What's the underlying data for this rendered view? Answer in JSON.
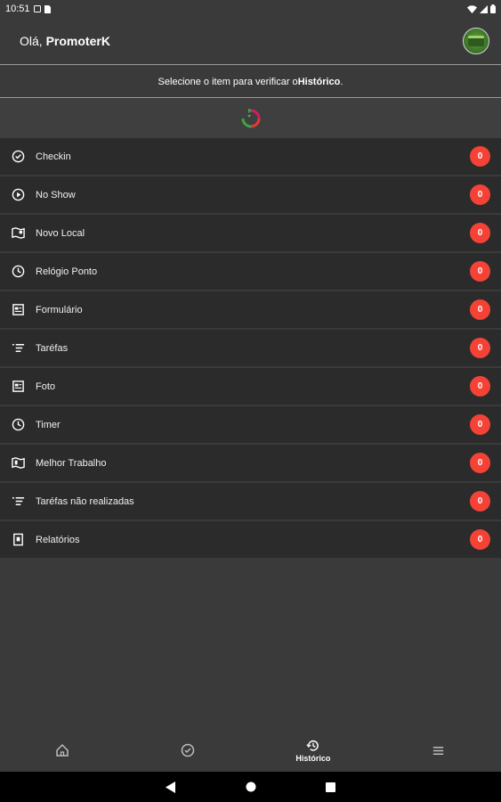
{
  "status_bar": {
    "time": "10:51"
  },
  "header": {
    "greeting_prefix": "Olá, ",
    "username": "PromoterK"
  },
  "banner": {
    "text_prefix": "Selecione o item para verificar o ",
    "text_bold": "Histórico",
    "text_suffix": "."
  },
  "list": [
    {
      "label": "Checkin",
      "count": "0",
      "icon": "check-circle-icon"
    },
    {
      "label": "No Show",
      "count": "0",
      "icon": "play-circle-icon"
    },
    {
      "label": "Novo Local",
      "count": "0",
      "icon": "map-icon"
    },
    {
      "label": "Relógio Ponto",
      "count": "0",
      "icon": "clock-icon"
    },
    {
      "label": "Formulário",
      "count": "0",
      "icon": "form-icon"
    },
    {
      "label": "Taréfas",
      "count": "0",
      "icon": "list-icon"
    },
    {
      "label": "Foto",
      "count": "0",
      "icon": "photo-icon"
    },
    {
      "label": "Timer",
      "count": "0",
      "icon": "clock-icon"
    },
    {
      "label": "Melhor Trabalho",
      "count": "0",
      "icon": "map-icon"
    },
    {
      "label": "Taréfas não realizadas",
      "count": "0",
      "icon": "list-icon"
    },
    {
      "label": "Relatórios",
      "count": "0",
      "icon": "report-icon"
    }
  ],
  "bottom_nav": {
    "active_label": "Histórico"
  },
  "colors": {
    "badge": "#f44336",
    "background": "#3a3a3a",
    "list_item": "#2b2b2b"
  }
}
